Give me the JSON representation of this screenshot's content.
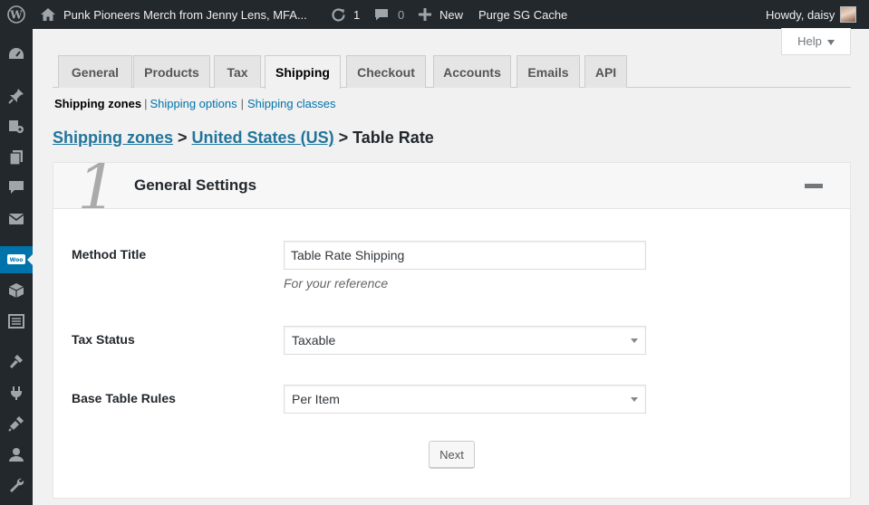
{
  "admin_bar": {
    "site_name": "Punk Pioneers Merch from Jenny Lens, MFA...",
    "updates_count": "1",
    "comments_count": "0",
    "new_label": "New",
    "cache_label": "Purge SG Cache",
    "greeting": "Howdy, daisy"
  },
  "sidebar": {
    "icons": [
      "dashboard-icon",
      "pin-icon",
      "media-icon",
      "pages-icon",
      "comments-icon",
      "mail-icon",
      "woocommerce-icon",
      "products-icon",
      "reports-icon",
      "appearance-icon",
      "plugins-icon",
      "plugins-alt-icon",
      "users-icon",
      "tools-icon"
    ]
  },
  "help_label": "Help",
  "tabs": [
    {
      "label": "General"
    },
    {
      "label": "Products"
    },
    {
      "label": "Tax"
    },
    {
      "label": "Shipping",
      "active": true
    },
    {
      "label": "Checkout"
    },
    {
      "label": "Accounts"
    },
    {
      "label": "Emails"
    },
    {
      "label": "API"
    }
  ],
  "subnav": {
    "current": "Shipping zones",
    "links": [
      "Shipping options",
      "Shipping classes"
    ],
    "separator": "|"
  },
  "breadcrumb": {
    "link1": "Shipping zones",
    "sep": ">",
    "link2": "United States (US)",
    "current": "Table Rate"
  },
  "panel": {
    "step_number": "1",
    "title": "General Settings",
    "method_title": {
      "label": "Method Title",
      "value": "Table Rate Shipping",
      "description": "For your reference"
    },
    "tax_status": {
      "label": "Tax Status",
      "value": "Taxable"
    },
    "base_rules": {
      "label": "Base Table Rules",
      "value": "Per Item"
    },
    "next_label": "Next"
  },
  "colors": {
    "accent": "#0073aa",
    "adminbar": "#23282d",
    "link": "#21759b"
  }
}
